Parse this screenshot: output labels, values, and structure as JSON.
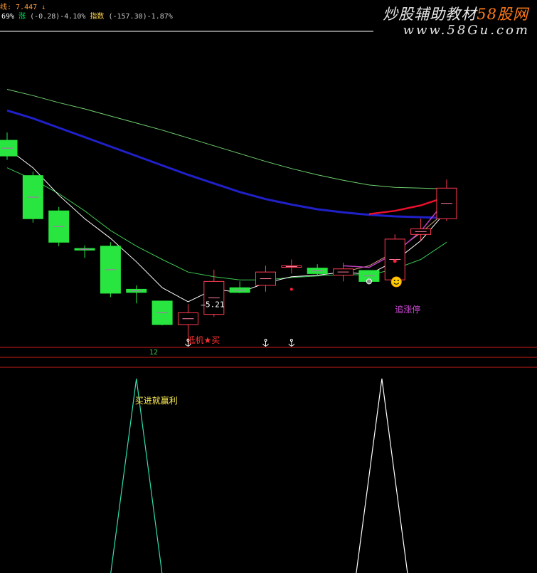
{
  "header": {
    "ma_label": "线: 7.447 ↓",
    "pct_prefix": "69% ",
    "rise_label": "涨 ",
    "rise_value": "(-0.28)-4.10% ",
    "index_label": "指数 ",
    "index_value": "(-157.30)-1.87%"
  },
  "watermark": {
    "line1_a": "炒股辅助教材",
    "line1_b": "58股网",
    "line2": "www.58Gu.com"
  },
  "annotations": {
    "low_price": "5.21",
    "buy_signal": "低机★买",
    "chase_limit": "追涨停",
    "period_num": "12",
    "sub_label": "买进就赢利"
  },
  "colors": {
    "up": "#ff3b52",
    "down": "#28e63f",
    "ma_short": "#ffffff",
    "ma_mid": "#3cc850",
    "ma_blue": "#2020c8",
    "ma_long": "#6fcf6f",
    "ma_red": "#e8102a",
    "ma_magenta": "#c040c0",
    "ma_tan": "#c8a070",
    "grid": "#cc1a1a",
    "sub_cyan": "#30e0b0",
    "sub_white": "#ffffff"
  },
  "chart_data": {
    "type": "candlestick",
    "low_price_marker": 5.21,
    "candles": [
      {
        "o": 7.3,
        "h": 7.4,
        "l": 7.05,
        "c": 7.1
      },
      {
        "o": 6.85,
        "h": 6.9,
        "l": 6.25,
        "c": 6.3
      },
      {
        "o": 6.4,
        "h": 6.45,
        "l": 5.95,
        "c": 6.0
      },
      {
        "o": 5.92,
        "h": 5.96,
        "l": 5.8,
        "c": 5.9
      },
      {
        "o": 5.95,
        "h": 6.0,
        "l": 5.3,
        "c": 5.35
      },
      {
        "o": 5.4,
        "h": 5.45,
        "l": 5.22,
        "c": 5.36
      },
      {
        "o": 5.25,
        "h": 5.25,
        "l": 4.94,
        "c": 4.95
      },
      {
        "o": 4.95,
        "h": 5.21,
        "l": 4.8,
        "c": 5.1
      },
      {
        "o": 5.08,
        "h": 5.65,
        "l": 5.05,
        "c": 5.5
      },
      {
        "o": 5.42,
        "h": 5.5,
        "l": 5.35,
        "c": 5.36
      },
      {
        "o": 5.45,
        "h": 5.7,
        "l": 5.37,
        "c": 5.62
      },
      {
        "o": 5.68,
        "h": 5.78,
        "l": 5.6,
        "c": 5.7
      },
      {
        "o": 5.67,
        "h": 5.72,
        "l": 5.58,
        "c": 5.6
      },
      {
        "o": 5.58,
        "h": 5.74,
        "l": 5.5,
        "c": 5.66
      },
      {
        "o": 5.64,
        "h": 5.64,
        "l": 5.48,
        "c": 5.5
      },
      {
        "o": 5.52,
        "h": 6.1,
        "l": 5.48,
        "c": 6.04
      },
      {
        "o": 6.1,
        "h": 6.3,
        "l": 6.02,
        "c": 6.17
      },
      {
        "o": 6.3,
        "h": 6.8,
        "l": 6.27,
        "c": 6.69
      }
    ],
    "ma_short": [
      7.2,
      6.95,
      6.6,
      6.3,
      6.05,
      5.75,
      5.42,
      5.24,
      5.4,
      5.36,
      5.48,
      5.56,
      5.58,
      5.62,
      5.59,
      5.76,
      6.02,
      6.4
    ],
    "ma_mid": [
      6.95,
      6.8,
      6.62,
      6.4,
      6.15,
      5.95,
      5.78,
      5.62,
      5.56,
      5.52,
      5.52,
      5.55,
      5.57,
      5.59,
      5.58,
      5.66,
      5.78,
      6.0
    ],
    "ma_blue": [
      7.68,
      7.58,
      7.46,
      7.34,
      7.22,
      7.1,
      6.98,
      6.86,
      6.75,
      6.64,
      6.55,
      6.48,
      6.42,
      6.38,
      6.35,
      6.33,
      6.32,
      6.31
    ],
    "ma_long": [
      7.95,
      7.87,
      7.78,
      7.7,
      7.61,
      7.52,
      7.43,
      7.33,
      7.23,
      7.13,
      7.03,
      6.94,
      6.86,
      6.79,
      6.73,
      6.7,
      6.69,
      6.68
    ],
    "ma_red": [
      null,
      null,
      null,
      null,
      null,
      null,
      null,
      null,
      null,
      null,
      null,
      null,
      null,
      null,
      6.36,
      6.4,
      6.47,
      6.58
    ],
    "ma_magenta": [
      null,
      null,
      null,
      null,
      null,
      null,
      null,
      null,
      null,
      null,
      null,
      null,
      null,
      5.7,
      5.68,
      5.86,
      6.14,
      6.55
    ],
    "ma_tan": [
      null,
      null,
      null,
      null,
      null,
      null,
      null,
      null,
      null,
      null,
      null,
      null,
      null,
      5.62,
      5.7,
      5.88,
      6.12,
      6.4
    ],
    "price_range": [
      4.75,
      8.0
    ],
    "sub_signal_bars": [
      5,
      14
    ]
  }
}
